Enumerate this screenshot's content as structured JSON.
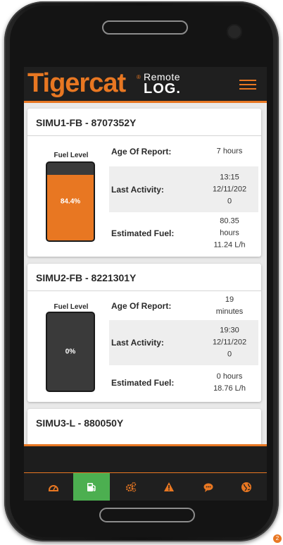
{
  "app": {
    "brand": "Tigercat",
    "registered_mark": "®",
    "product_top": "Remote",
    "product_bottom": "LOG."
  },
  "colors": {
    "accent": "#e87722",
    "active_tab": "#4caf50",
    "gauge_empty": "#3a3a3a"
  },
  "machines": [
    {
      "title": "SIMU1-FB - 8707352Y",
      "fuel_label": "Fuel Level",
      "fuel_level_percent": 84.4,
      "fuel_text": "84.4%",
      "rows": [
        {
          "label": "Age Of Report:",
          "value": "7 hours"
        },
        {
          "label": "Last Activity:",
          "value": "13:15\n12/11/202\n0"
        },
        {
          "label": "Estimated Fuel:",
          "value": "80.35\nhours\n11.24 L/h"
        }
      ]
    },
    {
      "title": "SIMU2-FB - 8221301Y",
      "fuel_label": "Fuel Level",
      "fuel_level_percent": 0,
      "fuel_text": "0%",
      "rows": [
        {
          "label": "Age Of Report:",
          "value": "19\nminutes"
        },
        {
          "label": "Last Activity:",
          "value": "19:30\n12/11/202\n0"
        },
        {
          "label": "Estimated Fuel:",
          "value": "0 hours\n18.76 L/h"
        }
      ]
    },
    {
      "title": "SIMU3-L - 880050Y"
    }
  ],
  "bottom_nav": [
    {
      "icon": "dashboard-gauge-icon",
      "active": false
    },
    {
      "icon": "fuel-pump-icon",
      "active": true
    },
    {
      "icon": "gears-icon",
      "active": false
    },
    {
      "icon": "warning-icon",
      "active": false
    },
    {
      "icon": "chat-icon",
      "active": false
    },
    {
      "icon": "globe-icon",
      "active": false
    }
  ],
  "notification_count": "2"
}
